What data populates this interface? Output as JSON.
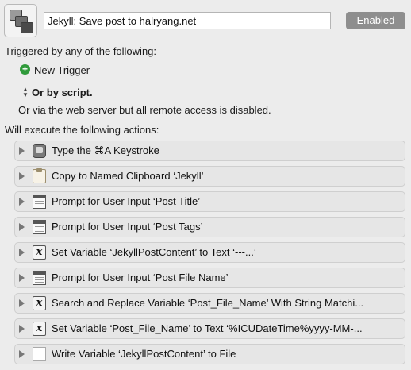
{
  "macro": {
    "title": "Jekyll: Save post to halryang.net",
    "enabled_label": "Enabled"
  },
  "triggers": {
    "heading": "Triggered by any of the following:",
    "new_trigger_label": "New Trigger",
    "or_by_script_label": "Or by script.",
    "web_server_note": "Or via the web server but all remote access is disabled."
  },
  "actions": {
    "heading": "Will execute the following actions:",
    "items": [
      {
        "label": "Type the ⌘A Keystroke",
        "icon": "keystroke-icon"
      },
      {
        "label": "Copy to Named Clipboard ‘Jekyll’",
        "icon": "clipboard-icon"
      },
      {
        "label": "Prompt for User Input ‘Post Title’",
        "icon": "prompt-window-icon"
      },
      {
        "label": "Prompt for User Input ‘Post Tags’",
        "icon": "prompt-window-icon"
      },
      {
        "label": "Set Variable ‘JekyllPostContent’ to Text ‘---...’",
        "icon": "variable-icon"
      },
      {
        "label": "Prompt for User Input ‘Post File Name’",
        "icon": "prompt-window-icon"
      },
      {
        "label": "Search and Replace Variable ‘Post_File_Name’ With String Matchi...",
        "icon": "variable-icon"
      },
      {
        "label": "Set Variable ‘Post_File_Name’ to Text ‘%ICUDateTime%yyyy-MM-...",
        "icon": "variable-icon"
      },
      {
        "label": "Write Variable ‘JekyllPostContent’ to File",
        "icon": "file-icon"
      }
    ]
  }
}
